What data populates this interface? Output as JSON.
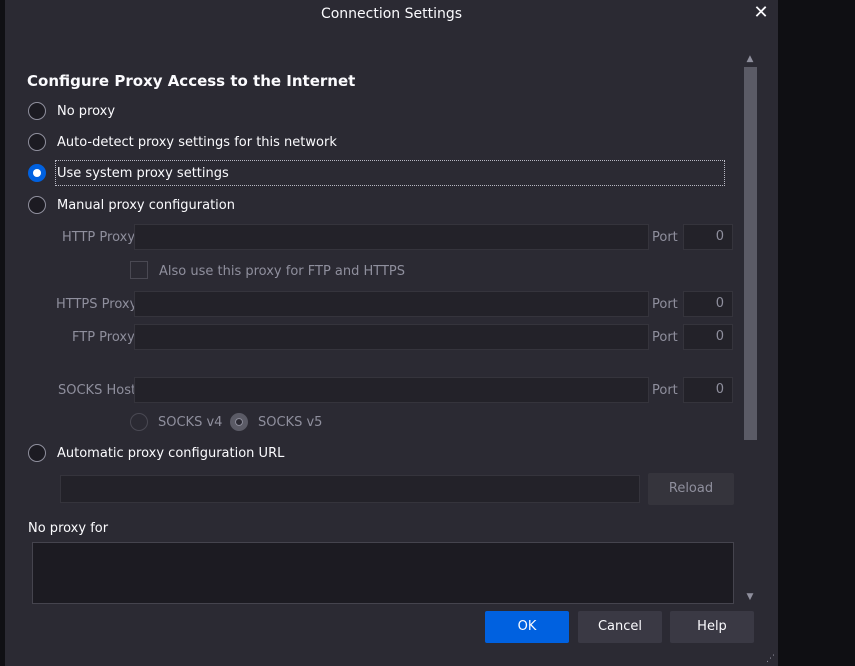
{
  "window": {
    "title": "Connection Settings",
    "close_glyph": "✕"
  },
  "heading": "Configure Proxy Access to the Internet",
  "proxy_options": {
    "no_proxy": {
      "label": "No proxy",
      "checked": false
    },
    "auto_detect": {
      "label": "Auto-detect proxy settings for this network",
      "checked": false
    },
    "system": {
      "label": "Use system proxy settings",
      "checked": true
    },
    "manual": {
      "label": "Manual proxy configuration",
      "checked": false
    },
    "auto_url": {
      "label": "Automatic proxy configuration URL",
      "checked": false
    }
  },
  "manual": {
    "http_label": "HTTP Proxy",
    "http_value": "",
    "port_label": "Port",
    "http_port": "0",
    "also_use_label": "Also use this proxy for FTP and HTTPS",
    "also_use_checked": false,
    "https_label": "HTTPS Proxy",
    "https_value": "",
    "https_port": "0",
    "ftp_label": "FTP Proxy",
    "ftp_value": "",
    "ftp_port": "0",
    "socks_label": "SOCKS Host",
    "socks_value": "",
    "socks_port": "0",
    "socks_v4_label": "SOCKS v4",
    "socks_v5_label": "SOCKS v5",
    "socks_version": "v5"
  },
  "auto_url": {
    "value": "",
    "reload_label": "Reload"
  },
  "no_proxy_for": {
    "label": "No proxy for",
    "value": ""
  },
  "buttons": {
    "ok": "OK",
    "cancel": "Cancel",
    "help": "Help"
  },
  "colors": {
    "accent": "#0061e0",
    "background": "#2b2a33",
    "text": "#fbfbfe",
    "disabled_text": "#8f8f9d"
  }
}
